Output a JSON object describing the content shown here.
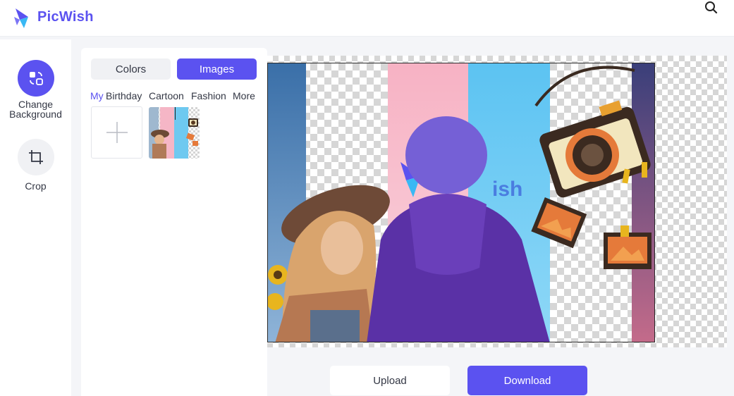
{
  "header": {
    "brand": "PicWish",
    "icons": {
      "logo": "picwish-logo-icon",
      "search": "search-icon"
    }
  },
  "sidebar": {
    "tools": [
      {
        "label": "Change Background",
        "icon": "change-background-icon",
        "active": true
      },
      {
        "label": "Crop",
        "icon": "crop-icon",
        "active": false
      }
    ]
  },
  "panel": {
    "tabs": {
      "colors": "Colors",
      "images": "Images"
    },
    "categories": [
      "My",
      "Birthday",
      "Cartoon",
      "Fashion",
      "More"
    ],
    "add_icon": "plus-icon"
  },
  "actions": {
    "upload": "Upload",
    "download": "Download"
  },
  "colors": {
    "accent": "#5b52f0",
    "text": "#333744",
    "background": "#f4f5f8"
  }
}
